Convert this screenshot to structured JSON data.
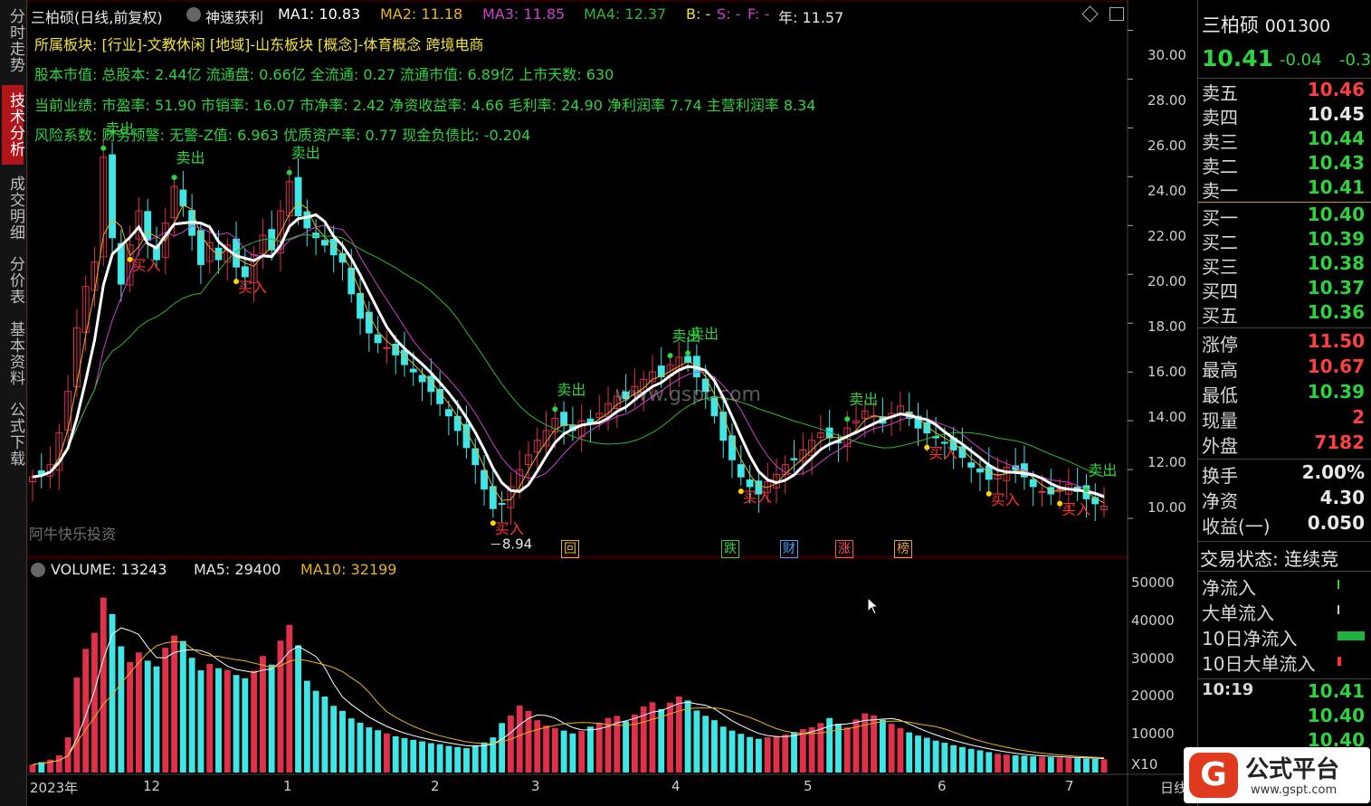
{
  "left_tabs": [
    {
      "label": "分时走势",
      "active": false
    },
    {
      "label": "技术分析",
      "active": true
    },
    {
      "label": "成交明细",
      "active": false
    },
    {
      "label": "分价表",
      "active": false
    },
    {
      "label": "基本资料",
      "active": false
    },
    {
      "label": "公式下载",
      "active": false
    }
  ],
  "header": {
    "title": "三柏硕(日线,前复权)",
    "formula": "神速获利",
    "ma1": "MA1: 10.83",
    "ma2": "MA2: 11.18",
    "ma3": "MA3: 11.85",
    "ma4": "MA4: 12.37",
    "b": "B: -",
    "s": "S: -",
    "f": "F: -",
    "year": "年: 11.57"
  },
  "info_lines": [
    "所属板块: [行业]-文教休闲 [地域]-山东板块 [概念]-体育概念 跨境电商",
    "股本市值: 总股本: 2.44亿 流通盘: 0.66亿 全流通: 0.27 流通市值: 6.89亿 上市天数: 630",
    "当前业绩: 市盈率: 51.90 市销率: 16.07 市净率: 2.42 净资收益率: 4.66 毛利率: 24.90 净利润率 7.74 主营利润率 8.34",
    "风险系数: 财务预警: 无警-Z值: 6.963 优质资产率: 0.77 现金负债比: -0.204"
  ],
  "watermark": "www.gspt.com",
  "watermark2": "阿牛快乐投资",
  "min_label": "8.94",
  "signal_labels": {
    "sell": "卖出",
    "buy": "买入"
  },
  "event_tags": [
    "回",
    "跌",
    "财",
    "涨",
    "榜"
  ],
  "price_axis": [
    "30.00",
    "28.00",
    "26.00",
    "24.00",
    "22.00",
    "20.00",
    "18.00",
    "16.00",
    "14.00",
    "12.00",
    "10.00"
  ],
  "volume_header": {
    "volume": "VOLUME: 13243",
    "ma5": "MA5: 29400",
    "ma10": "MA10: 32199"
  },
  "volume_axis": [
    "50000",
    "40000",
    "30000",
    "20000",
    "10000"
  ],
  "volume_unit": "X10",
  "date_axis": [
    "2023年",
    "12",
    "1",
    "2",
    "3",
    "4",
    "5",
    "6",
    "7"
  ],
  "period": "日线",
  "stock": {
    "name": "三柏硕",
    "code": "001300",
    "price": "10.41",
    "change": "-0.04",
    "pct": "-0.3"
  },
  "asks": [
    {
      "label": "卖五",
      "price": "10.46"
    },
    {
      "label": "卖四",
      "price": "10.45"
    },
    {
      "label": "卖三",
      "price": "10.44"
    },
    {
      "label": "卖二",
      "price": "10.43"
    },
    {
      "label": "卖一",
      "price": "10.41"
    }
  ],
  "bids": [
    {
      "label": "买一",
      "price": "10.40"
    },
    {
      "label": "买二",
      "price": "10.39"
    },
    {
      "label": "买三",
      "price": "10.38"
    },
    {
      "label": "买四",
      "price": "10.37"
    },
    {
      "label": "买五",
      "price": "10.36"
    }
  ],
  "stats": [
    {
      "label": "涨停",
      "value": "11.50"
    },
    {
      "label": "最高",
      "value": "10.67"
    },
    {
      "label": "最低",
      "value": "10.39"
    },
    {
      "label": "现量",
      "value": "2"
    },
    {
      "label": "外盘",
      "value": "7182"
    }
  ],
  "stats2": [
    {
      "label": "换手",
      "value": "2.00%"
    },
    {
      "label": "净资",
      "value": "4.30"
    },
    {
      "label": "收益(一)",
      "value": "0.050"
    }
  ],
  "trade_status": "交易状态: 连续竞",
  "flows": [
    {
      "label": "净流入"
    },
    {
      "label": "大单流入"
    },
    {
      "label": "10日净流入"
    },
    {
      "label": "10日大单流入"
    }
  ],
  "ticks": [
    {
      "time": "10:19",
      "price": "10.41"
    },
    {
      "time": "",
      "price": "10.40"
    },
    {
      "time": "",
      "price": "10.40"
    }
  ],
  "logo": {
    "text": "公式平台",
    "url": "www.gspt.com"
  },
  "colors": {
    "up": "#e0304a",
    "down": "#3ee6e6",
    "ma1": "#ffffff",
    "ma2": "#e6b422",
    "ma3": "#d040d0",
    "ma4": "#2fb82f",
    "sell": "#2fd33f",
    "buy": "#ff3030"
  },
  "chart_data": {
    "type": "candlestick",
    "price_range": [
      9,
      30.5
    ],
    "close": [
      11.7,
      11.8,
      12.2,
      13.5,
      15.2,
      17.8,
      19.5,
      20.5,
      24.8,
      21.5,
      19.6,
      21.2,
      22.6,
      21.4,
      20.6,
      22.1,
      23.6,
      22.8,
      21.6,
      20.4,
      21.3,
      20.6,
      21.2,
      20.3,
      19.9,
      20.8,
      21.6,
      21.0,
      22.6,
      23.8,
      22.4,
      21.9,
      21.5,
      21.2,
      20.8,
      20.5,
      19.2,
      18.2,
      17.6,
      17.2,
      17.0,
      16.7,
      16.3,
      16.0,
      15.6,
      15.2,
      14.7,
      14.2,
      13.6,
      12.9,
      12.2,
      11.2,
      10.4,
      10.6,
      11.3,
      12.0,
      12.6,
      13.2,
      13.6,
      14.1,
      13.8,
      13.6,
      14.0,
      13.9,
      14.3,
      14.7,
      15.0,
      14.9,
      15.4,
      15.7,
      16.0,
      15.8,
      16.3,
      16.6,
      16.4,
      15.8,
      15.2,
      14.2,
      13.2,
      12.4,
      11.7,
      11.3,
      11.0,
      11.5,
      11.8,
      12.2,
      12.4,
      12.8,
      13.2,
      13.5,
      13.3,
      13.1,
      13.7,
      14.0,
      14.4,
      14.2,
      13.9,
      14.3,
      14.6,
      14.1,
      13.7,
      13.5,
      13.3,
      13.1,
      12.8,
      12.5,
      12.1,
      11.9,
      11.6,
      11.8,
      12.1,
      12.0,
      11.7,
      11.3,
      11.1,
      11.0,
      11.2,
      11.4,
      11.1,
      10.8,
      10.6,
      10.5
    ],
    "volume": [
      2200,
      2900,
      3600,
      4800,
      9800,
      26500,
      34500,
      39000,
      48800,
      44200,
      35200,
      30800,
      33500,
      31200,
      29600,
      34800,
      38200,
      36700,
      32000,
      28500,
      30300,
      29100,
      28600,
      27200,
      26300,
      28400,
      32500,
      30100,
      36800,
      41200,
      35500,
      25600,
      22800,
      21200,
      18600,
      17200,
      15100,
      13900,
      12600,
      11800,
      10900,
      10100,
      9600,
      9100,
      8700,
      8200,
      7900,
      7400,
      7100,
      6800,
      7600,
      8400,
      9800,
      13800,
      15900,
      18700,
      17200,
      14600,
      13100,
      12400,
      11700,
      10900,
      11600,
      12800,
      13900,
      15200,
      15800,
      14300,
      16200,
      18400,
      19600,
      17700,
      19500,
      21200,
      20100,
      17300,
      15800,
      14600,
      12800,
      11700,
      10800,
      9900,
      9400,
      9800,
      10200,
      10600,
      11300,
      12100,
      12600,
      13800,
      15200,
      13600,
      12600,
      14800,
      16500,
      15900,
      14700,
      13600,
      12400,
      11200,
      10300,
      9700,
      8900,
      8300,
      7600,
      7100,
      6600,
      6200,
      5700,
      5200,
      5000,
      4800,
      4700,
      4500,
      4400,
      4300,
      4200,
      4100,
      4000,
      3900,
      3800,
      3700
    ],
    "volume_range": [
      0,
      54000
    ],
    "markers": {
      "sell": [
        "卖出",
        "卖出",
        "卖出",
        "卖出",
        "卖出",
        "卖出",
        "卖出",
        "卖出"
      ],
      "buy": [
        "买入",
        "买入",
        "买入",
        "买入",
        "买入",
        "买入",
        "买入"
      ]
    }
  }
}
